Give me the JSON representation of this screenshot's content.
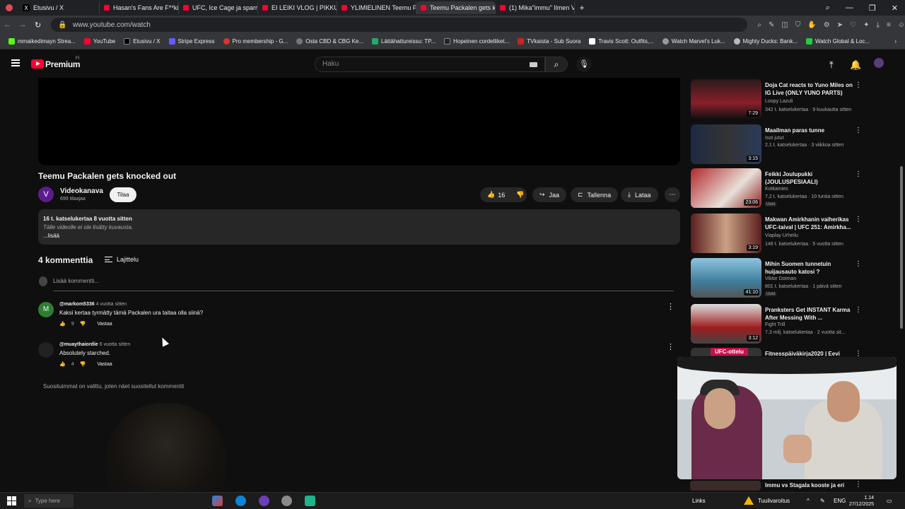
{
  "tabs": [
    {
      "label": "Etusivu / X",
      "favicon": "x-logo"
    },
    {
      "label": "Hasan's Fans Are F**king",
      "favicon": "youtube"
    },
    {
      "label": "UFC, Ice Cage ja sparraa",
      "favicon": "youtube"
    },
    {
      "label": "EI LEIKI VLOG | PIKKUVEL",
      "favicon": "youtube"
    },
    {
      "label": "YLIMIELINEN Teemu P",
      "favicon": "youtube"
    },
    {
      "label": "Teemu Packalen gets kno",
      "favicon": "youtube",
      "active": true
    },
    {
      "label": "(1) Mika\"immu\" Ilmen VS",
      "favicon": "youtube"
    }
  ],
  "address": {
    "url": "www.youtube.com/watch"
  },
  "bookmarks": [
    "mmaikedimayn Strea...",
    "YouTube",
    "Etusivu / X",
    "Stripe Express",
    "Pro membership - G...",
    "Osta CBD & CBG Ke...",
    "Lättähattureissu: TP...",
    "Hopeinen cordelliket...",
    "TVkaista - Sub Suora",
    "Travis Scott: Outfits,...",
    "Watch Marvel's Luk...",
    "Mighty Ducks: Bank...",
    "Watch Global & Loc..."
  ],
  "header": {
    "premium_label": "Premium",
    "region": "FI",
    "search_placeholder": "Haku"
  },
  "video": {
    "title": "Teemu Packalen gets knocked out",
    "channel_initial": "V",
    "channel_name": "Videokanava",
    "subscribers": "699 tilaajaa",
    "subscribe_label": "Tilaa",
    "likes": "16",
    "share_label": "Jaa",
    "save_label": "Tallenna",
    "download_label": "Lataa"
  },
  "description": {
    "stats": "16 t. katselukertaa  8 vuotta sitten",
    "text": "Tälle videolle ei ole lisätty kuvausta.",
    "more": "...lisää"
  },
  "comments": {
    "count_label": "4 kommenttia",
    "sort_label": "Lajittelu",
    "add_placeholder": "Lisää kommentti...",
    "items": [
      {
        "initial": "M",
        "author": "@markom5336",
        "time": "4 vuotta sitten",
        "text": "Kaksi kertaa tyrmätty tämä Packalen ura taitaa olla siinä?",
        "likes": "9",
        "reply": "Vastaa",
        "avatar_color": "#2e7d32"
      },
      {
        "initial": "",
        "author": "@muaythaiordie",
        "time": "6 vuotta sitten",
        "text": "Absolutely starched.",
        "likes": "4",
        "reply": "Vastaa",
        "avatar_color": "#222222"
      }
    ],
    "note": "Suosituimmat on valittu, joten näet suositellut kommentit"
  },
  "recommendations": [
    {
      "title": "Doja Cat reacts to Yuno Miles on IG Live (ONLY YUNO PARTS)",
      "channel": "Loopy Lazuli",
      "meta": "342 t. katselukertaa · 9 kuukautta sitten",
      "duration": "7:29",
      "thumb_color": "#8a1f2a",
      "new": ""
    },
    {
      "title": "Maailman paras tunne",
      "channel": "Isot jutut",
      "meta": "2,1 t. katselukertaa · 3 viikkoa sitten",
      "duration": "3:15",
      "thumb_color": "#1d2a44",
      "new": ""
    },
    {
      "title": "Feikki Joulupukki (JOULUSPESIAALI)",
      "channel": "Kotkamies",
      "meta": "7,2 t. katselukertaa · 10 tuntia sitten",
      "duration": "23:06",
      "thumb_color": "#b3262b",
      "new": "Uusi"
    },
    {
      "title": "Makwan Amirkhanin vaiherikas UFC-taival | UFC 251: Amirkha...",
      "channel": "Viaplay Urheilu",
      "meta": "148 t. katselukertaa · 5 vuotta sitten",
      "duration": "3:19",
      "thumb_color": "#5a1f1f",
      "new": ""
    },
    {
      "title": "Mihin Suomen tunnetuin huijausauto katosi ?",
      "channel": "Viktor Dotman",
      "meta": "801 t. katselukertaa · 1 päivä sitten",
      "duration": "41:10",
      "thumb_color": "#3e7d9a",
      "new": "Uusi"
    },
    {
      "title": "Pranksters Get INSTANT Karma After Messing With ...",
      "channel": "Fight Trill",
      "meta": "7,3 milj. katselukertaa · 2 vuotta sit...",
      "duration": "3:12",
      "thumb_color": "#9c1c1c",
      "new": ""
    },
    {
      "title": "Fitnesspäiväkirja2020 | Eevi",
      "channel": "",
      "meta": "",
      "duration": "",
      "thumb_color": "#c4124a",
      "new": ""
    }
  ],
  "pip": {
    "badge": "UFC-ottelu",
    "caption": "Immu vs Stagala kooste ja eri"
  },
  "taskbar": {
    "search": "Type here",
    "links": "Links",
    "weather": "Tuulivaroitus",
    "lang": "ENG",
    "time": "1.14",
    "date": "27/12/2025"
  }
}
